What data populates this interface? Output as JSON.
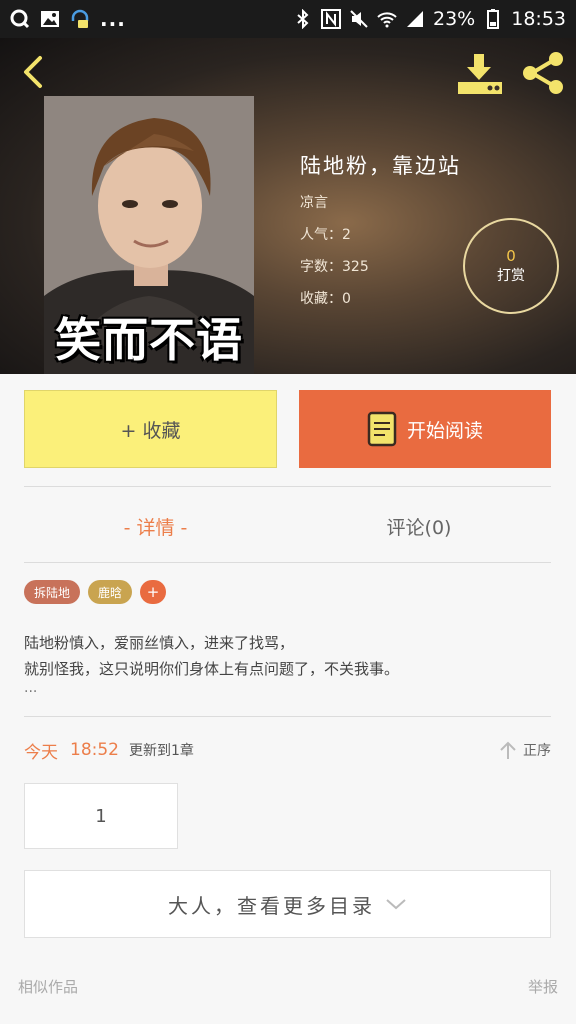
{
  "status_bar": {
    "battery": "23%",
    "time": "18:53",
    "more_indicator": "..."
  },
  "header": {
    "back_icon": "chevron-left-icon",
    "download_icon": "download-icon",
    "share_icon": "share-icon"
  },
  "book": {
    "cover_caption": "笑而不语",
    "title": "陆地粉，靠边站",
    "author": "凉言",
    "popularity_label": "人气：",
    "popularity_value": "2",
    "word_count_label": "字数：",
    "word_count_value": "325",
    "favorites_label": "收藏：",
    "favorites_value": "0"
  },
  "reward": {
    "count": "0",
    "label": "打赏"
  },
  "actions": {
    "collect_label": "+ 收藏",
    "read_label": "开始阅读"
  },
  "tabs": {
    "details": "- 详情 -",
    "comments": "评论(0)"
  },
  "tags": [
    {
      "label": "拆陆地",
      "color": "#c8725a"
    },
    {
      "label": "鹿晗",
      "color": "#c9a450"
    },
    {
      "label": "+",
      "color": "#e96b40"
    }
  ],
  "description": {
    "line1": "陆地粉慎入，爱丽丝慎入，进来了找骂，",
    "line2": "就别怪我，这只说明你们身体上有点问题了，不关我事。",
    "ellipsis": "..."
  },
  "update": {
    "day": "今天",
    "time": "18:52",
    "text": "更新到1章",
    "sort_label": "正序"
  },
  "chapter": {
    "number": "1"
  },
  "more_catalog": {
    "label": "大人，查看更多目录"
  },
  "footer": {
    "similar": "相似作品",
    "report": "举报"
  },
  "colors": {
    "accent_orange": "#e96b40",
    "collect_yellow": "#fbf07a",
    "reward_gold": "#f4c64a",
    "header_icon_yellow": "#f3e36b"
  }
}
